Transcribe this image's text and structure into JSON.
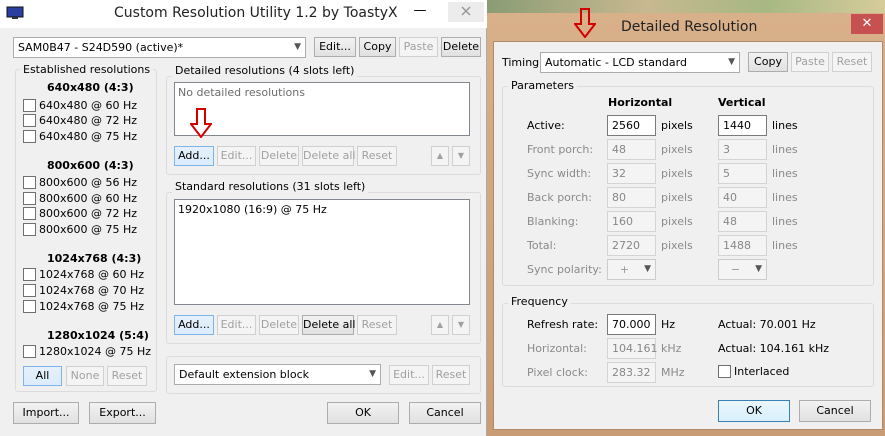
{
  "main_window": {
    "title": "Custom Resolution Utility 1.2 by ToastyX",
    "monitor_select": "SAM0B47 - S24D590 (active)*",
    "edit_btn": "Edit...",
    "copy_btn": "Copy",
    "paste_btn": "Paste",
    "delete_btn": "Delete",
    "established_label": "Established resolutions",
    "groups": [
      {
        "heading": "640x480 (4:3)",
        "items": [
          "640x480 @ 60 Hz",
          "640x480 @ 72 Hz",
          "640x480 @ 75 Hz"
        ]
      },
      {
        "heading": "800x600 (4:3)",
        "items": [
          "800x600 @ 56 Hz",
          "800x600 @ 60 Hz",
          "800x600 @ 72 Hz",
          "800x600 @ 75 Hz"
        ]
      },
      {
        "heading": "1024x768 (4:3)",
        "items": [
          "1024x768 @ 60 Hz",
          "1024x768 @ 70 Hz",
          "1024x768 @ 75 Hz"
        ]
      },
      {
        "heading": "1280x1024 (5:4)",
        "items": [
          "1280x1024 @ 75 Hz"
        ]
      }
    ],
    "all_btn": "All",
    "none_btn": "None",
    "reset_btn": "Reset",
    "detailed_label": "Detailed resolutions (4 slots left)",
    "detailed_empty": "No detailed resolutions",
    "standard_label": "Standard resolutions (31 slots left)",
    "standard_items": [
      "1920x1080 (16:9) @ 75 Hz"
    ],
    "add_btn": "Add...",
    "delete_all_btn": "Delete all",
    "up_icon": "▲",
    "down_icon": "▼",
    "extension_select": "Default extension block",
    "import_btn": "Import...",
    "export_btn": "Export...",
    "ok_btn": "OK",
    "cancel_btn": "Cancel"
  },
  "dialog": {
    "title": "Detailed Resolution",
    "close_icon": "✕",
    "timing_label": "Timing:",
    "timing_select": "Automatic - LCD standard",
    "copy_btn": "Copy",
    "paste_btn": "Paste",
    "reset_btn": "Reset",
    "parameters_label": "Parameters",
    "col_horizontal": "Horizontal",
    "col_vertical": "Vertical",
    "rows": [
      {
        "label": "Active:",
        "h": "2560",
        "hu": "pixels",
        "v": "1440",
        "vu": "lines",
        "enabled": true
      },
      {
        "label": "Front porch:",
        "h": "48",
        "hu": "pixels",
        "v": "3",
        "vu": "lines",
        "enabled": false
      },
      {
        "label": "Sync width:",
        "h": "32",
        "hu": "pixels",
        "v": "5",
        "vu": "lines",
        "enabled": false
      },
      {
        "label": "Back porch:",
        "h": "80",
        "hu": "pixels",
        "v": "40",
        "vu": "lines",
        "enabled": false
      },
      {
        "label": "Blanking:",
        "h": "160",
        "hu": "pixels",
        "v": "48",
        "vu": "lines",
        "enabled": false
      },
      {
        "label": "Total:",
        "h": "2720",
        "hu": "pixels",
        "v": "1488",
        "vu": "lines",
        "enabled": false
      }
    ],
    "sync_polarity_label": "Sync polarity:",
    "sync_h": "+",
    "sync_v": "−",
    "frequency_label": "Frequency",
    "refresh_label": "Refresh rate:",
    "refresh_value": "70.000",
    "refresh_unit": "Hz",
    "refresh_actual": "Actual: 70.001 Hz",
    "horizontal_label": "Horizontal:",
    "horizontal_value": "104.161",
    "horizontal_unit": "kHz",
    "horizontal_actual": "Actual: 104.161 kHz",
    "pixel_clock_label": "Pixel clock:",
    "pixel_clock_value": "283.32",
    "pixel_clock_unit": "MHz",
    "interlaced_label": "Interlaced",
    "ok_btn": "OK",
    "cancel_btn": "Cancel"
  },
  "colors": {
    "annotation_arrow": "#d40000",
    "close_button": "#c75050"
  }
}
